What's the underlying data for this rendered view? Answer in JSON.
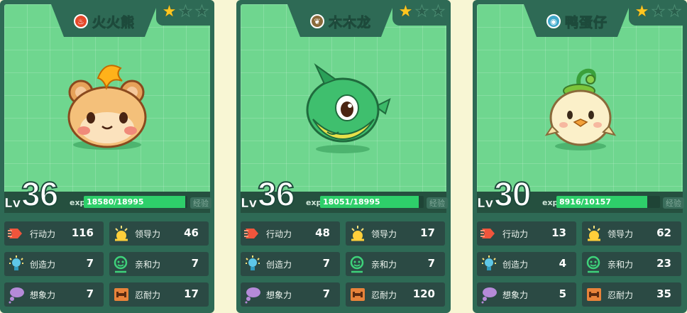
{
  "cards": [
    {
      "name": "火火熊",
      "element": "fire",
      "stars": [
        "★",
        "★",
        "★"
      ],
      "stars_filled": 1,
      "lv_label": "Lv",
      "level": "36",
      "exp_label": "exp",
      "exp_current": "18580",
      "exp_sep": "/",
      "exp_max": "18995",
      "exp_fraction": 0.978,
      "badge": "经验",
      "stats": [
        {
          "label": "行动力",
          "value": "116",
          "icon": "action-icon"
        },
        {
          "label": "领导力",
          "value": "46",
          "icon": "leadership-icon"
        },
        {
          "label": "创造力",
          "value": "7",
          "icon": "creativity-icon"
        },
        {
          "label": "亲和力",
          "value": "7",
          "icon": "affinity-icon"
        },
        {
          "label": "想象力",
          "value": "7",
          "icon": "imagination-icon"
        },
        {
          "label": "忍耐力",
          "value": "17",
          "icon": "endurance-icon"
        }
      ]
    },
    {
      "name": "木木龙",
      "element": "grass",
      "stars": [
        "★",
        "★",
        "★"
      ],
      "stars_filled": 1,
      "lv_label": "Lv",
      "level": "36",
      "exp_label": "exp",
      "exp_current": "18051",
      "exp_sep": "/",
      "exp_max": "18995",
      "exp_fraction": 0.95,
      "badge": "经验",
      "stats": [
        {
          "label": "行动力",
          "value": "48",
          "icon": "action-icon"
        },
        {
          "label": "领导力",
          "value": "17",
          "icon": "leadership-icon"
        },
        {
          "label": "创造力",
          "value": "7",
          "icon": "creativity-icon"
        },
        {
          "label": "亲和力",
          "value": "7",
          "icon": "affinity-icon"
        },
        {
          "label": "想象力",
          "value": "7",
          "icon": "imagination-icon"
        },
        {
          "label": "忍耐力",
          "value": "120",
          "icon": "endurance-icon"
        }
      ]
    },
    {
      "name": "鸭蛋仔",
      "element": "water",
      "stars": [
        "★",
        "★",
        "★"
      ],
      "stars_filled": 1,
      "lv_label": "Lv",
      "level": "30",
      "exp_label": "exp",
      "exp_current": "8916",
      "exp_sep": "/",
      "exp_max": "10157",
      "exp_fraction": 0.878,
      "badge": "经验",
      "stats": [
        {
          "label": "行动力",
          "value": "13",
          "icon": "action-icon"
        },
        {
          "label": "领导力",
          "value": "62",
          "icon": "leadership-icon"
        },
        {
          "label": "创造力",
          "value": "4",
          "icon": "creativity-icon"
        },
        {
          "label": "亲和力",
          "value": "23",
          "icon": "affinity-icon"
        },
        {
          "label": "想象力",
          "value": "5",
          "icon": "imagination-icon"
        },
        {
          "label": "忍耐力",
          "value": "35",
          "icon": "endurance-icon"
        }
      ]
    }
  ],
  "colors": {
    "card_bg": "#2e6a55",
    "portrait_bg": "#6fd68f",
    "exp_fill": "#2ecf6a",
    "star_on": "#ffc620",
    "stat_bg": "#2b4a44",
    "page_bg": "#f8f6d4"
  }
}
